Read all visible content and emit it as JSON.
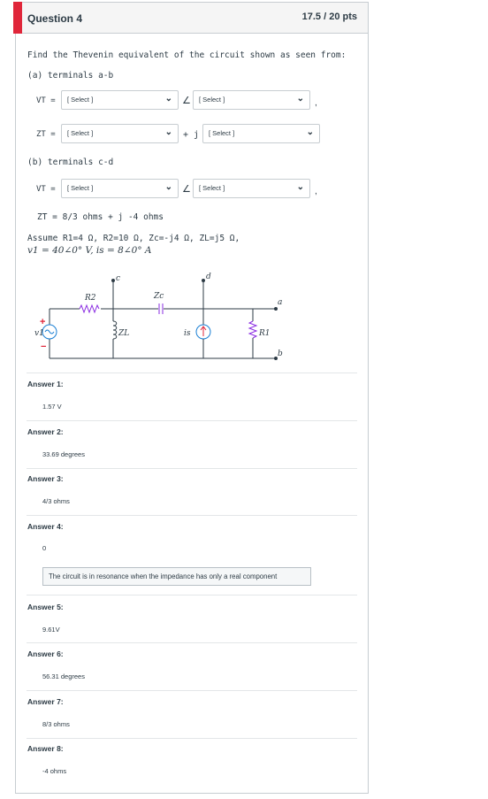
{
  "question": {
    "title": "Question 4",
    "points": "17.5 / 20 pts",
    "prompt": "Find the Thevenin equivalent of the circuit shown as seen from:",
    "part_a": "(a) terminals a-b",
    "part_b": "(b) terminals c-d",
    "vt_label": "VT =",
    "zt_label": "ZT =",
    "select_placeholder": "[ Select ]",
    "plus_j": "+ j",
    "zt_result": "ZT = 8/3 ohms + j -4 ohms",
    "assume": "Assume R1=4 Ω, R2=10 Ω, Zc=-j4 Ω, ZL=j5 Ω,",
    "sources": "v1 = 40∠0° V, is = 8∠0° A",
    "comma": ","
  },
  "circuit": {
    "labels": {
      "r2": "R2",
      "zc": "Zc",
      "zl": "ZL",
      "r1": "R1",
      "v1": "v1",
      "is": "is",
      "c": "c",
      "d": "d",
      "a": "a",
      "b": "b",
      "plus": "+",
      "minus": "−"
    }
  },
  "answers": [
    {
      "label": "Answer 1:",
      "value": "1.57 V"
    },
    {
      "label": "Answer 2:",
      "value": "33.69 degrees"
    },
    {
      "label": "Answer 3:",
      "value": "4/3 ohms"
    },
    {
      "label": "Answer 4:",
      "value": "0"
    },
    {
      "label": "Answer 5:",
      "value": "9.61V"
    },
    {
      "label": "Answer 6:",
      "value": "56.31 degrees"
    },
    {
      "label": "Answer 7:",
      "value": "8/3 ohms"
    },
    {
      "label": "Answer 8:",
      "value": "-4 ohms"
    }
  ],
  "answer4_note": "The circuit is in resonance when the impedance has only a real component"
}
